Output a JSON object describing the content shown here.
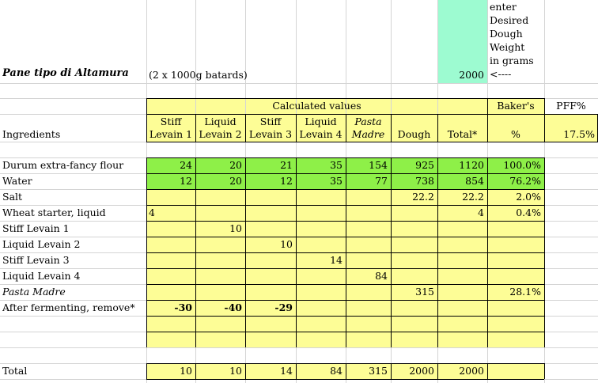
{
  "colors": {
    "yellow": "#fdfd96",
    "green": "#8ef048",
    "mint": "#9dfbd1",
    "grid": "#d4d4d4"
  },
  "title": "Pane tipo di Altamura",
  "batch_note": "(2 x 1000g batards)",
  "desired_weight": {
    "value": "2000",
    "note_lines": [
      "enter",
      "Desired",
      "Dough",
      "Weight",
      "in grams",
      "<----"
    ]
  },
  "calc_header": "Calculated values",
  "bakers_header": [
    "Baker's",
    "%"
  ],
  "pff": {
    "label": "PFF%",
    "value": "17.5%"
  },
  "ingredients_header": "Ingredients",
  "columns": [
    [
      "Stiff",
      "Levain 1"
    ],
    [
      "Liquid",
      "Levain 2"
    ],
    [
      "Stiff",
      "Levain 3"
    ],
    [
      "Liquid",
      "Levain 4"
    ],
    [
      "Pasta",
      "Madre"
    ],
    [
      "Dough"
    ],
    [
      "Total*"
    ]
  ],
  "rows": [
    {
      "name": "Durum extra-fancy flour",
      "cells": [
        "24",
        "20",
        "21",
        "35",
        "154",
        "925",
        "1120",
        "100.0%"
      ],
      "fill": "green"
    },
    {
      "name": "Water",
      "cells": [
        "12",
        "20",
        "12",
        "35",
        "77",
        "738",
        "854",
        "76.2%"
      ],
      "fill": "green"
    },
    {
      "name": "Salt",
      "cells": [
        "",
        "",
        "",
        "",
        "",
        "22.2",
        "22.2",
        "2.0%"
      ]
    },
    {
      "name": "Wheat starter, liquid",
      "cells": [
        "4",
        "",
        "",
        "",
        "",
        "",
        "4",
        "0.4%"
      ],
      "leftFirst": true
    },
    {
      "name": "Stiff Levain 1",
      "cells": [
        "",
        "10",
        "",
        "",
        "",
        "",
        "",
        ""
      ]
    },
    {
      "name": "Liquid Levain 2",
      "cells": [
        "",
        "",
        "10",
        "",
        "",
        "",
        "",
        ""
      ]
    },
    {
      "name": "Stiff Levain 3",
      "cells": [
        "",
        "",
        "",
        "14",
        "",
        "",
        "",
        ""
      ]
    },
    {
      "name": "Liquid Levain 4",
      "cells": [
        "",
        "",
        "",
        "",
        "84",
        "",
        "",
        ""
      ]
    },
    {
      "name": "Pasta Madre",
      "italic": true,
      "cells": [
        "",
        "",
        "",
        "",
        "",
        "315",
        "",
        "28.1%"
      ]
    },
    {
      "name": "After fermenting, remove*",
      "bold": true,
      "cells": [
        "-30",
        "-40",
        "-29",
        "",
        "",
        "",
        "",
        ""
      ]
    },
    {
      "name": "",
      "cells": [
        "",
        "",
        "",
        "",
        "",
        "",
        "",
        ""
      ]
    },
    {
      "name": "",
      "cells": [
        "",
        "",
        "",
        "",
        "",
        "",
        "",
        ""
      ]
    }
  ],
  "total": {
    "name": "Total",
    "cells": [
      "10",
      "10",
      "14",
      "84",
      "315",
      "2000",
      "2000"
    ]
  }
}
